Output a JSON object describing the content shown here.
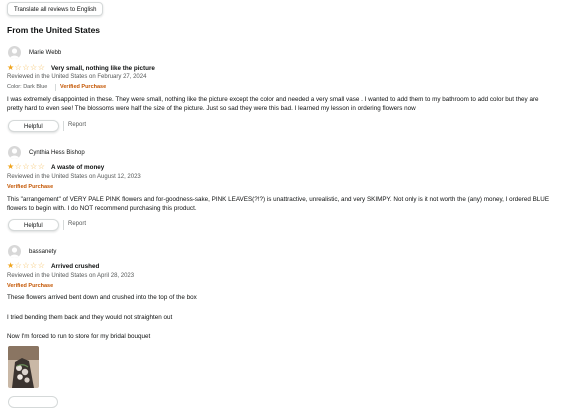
{
  "translate_button": "Translate all reviews to English",
  "section_title": "From the United States",
  "reviews": [
    {
      "reviewer": "Marie Webb",
      "rating": 1,
      "title": "Very small, nothing like the picture",
      "date_line": "Reviewed in the United States on February 27, 2024",
      "variant": "Color: Dark Blue",
      "verified": "Verified Purchase",
      "body": "I was extremely disappointed in these. They were small, nothing like the picture except the color and needed a very small vase . I wanted to add them to my bathroom to add color but they are pretty hard to even see! The blossoms were half the size of the picture. Just so sad they were this bad. I learned my lesson in ordering flowers now",
      "helpful": "Helpful",
      "report": "Report"
    },
    {
      "reviewer": "Cynthia Hess Bishop",
      "rating": 1,
      "title": "A waste of money",
      "date_line": "Reviewed in the United States on August 12, 2023",
      "verified": "Verified Purchase",
      "body": "This \"arrangement\" of VERY PALE PINK flowers and for-goodness-sake, PINK LEAVES(?!?) is unattractive, unrealistic, and very SKIMPY. Not only is it not worth the (any) money, I ordered BLUE flowers to begin with. I do NOT recommend purchasing this product.",
      "helpful": "Helpful",
      "report": "Report"
    },
    {
      "reviewer": "bassanety",
      "rating": 1,
      "title": "Arrived crushed",
      "date_line": "Reviewed in the United States on April 28, 2023",
      "verified": "Verified Purchase",
      "body_lines": [
        "These flowers arrived bent down and crushed into the top of the box",
        "I tried bending them back and they would not straighten out",
        "Now I'm forced to run to store for my bridal bouquet"
      ]
    }
  ],
  "colors": {
    "star": "#f0a51e",
    "verified": "#c45500",
    "meta": "#565959"
  }
}
